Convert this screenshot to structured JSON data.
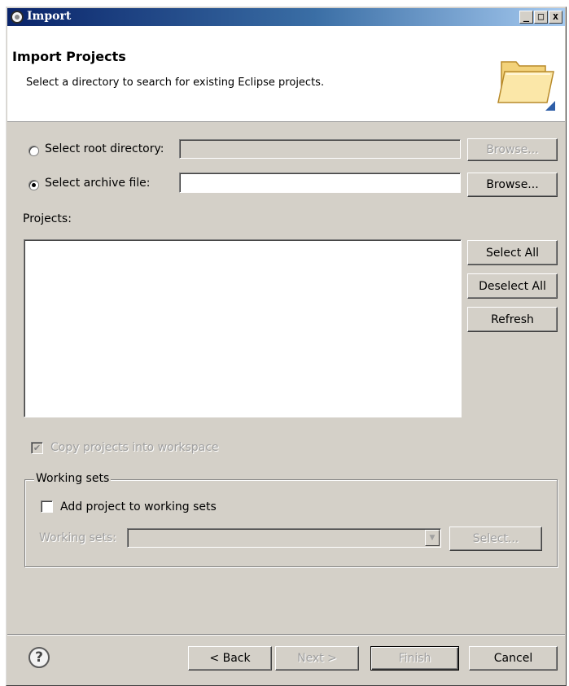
{
  "window": {
    "title": "Import",
    "minimize_label": "_",
    "maximize_label": "□",
    "close_label": "x"
  },
  "banner": {
    "title": "Import Projects",
    "description": "Select a directory to search for existing Eclipse projects."
  },
  "source": {
    "root_directory": {
      "label": "Select root directory:",
      "selected": false,
      "value": "",
      "browse_label": "Browse...",
      "browse_enabled": false
    },
    "archive_file": {
      "label": "Select archive file:",
      "selected": true,
      "value": "",
      "browse_label": "Browse...",
      "browse_enabled": true
    }
  },
  "projects": {
    "label": "Projects:",
    "items": [],
    "select_all_label": "Select All",
    "deselect_all_label": "Deselect All",
    "refresh_label": "Refresh"
  },
  "copy_projects": {
    "label": "Copy projects into workspace",
    "checked": true,
    "enabled": false
  },
  "working_sets_group": {
    "title": "Working sets",
    "add_label": "Add project to working sets",
    "add_checked": false,
    "sets_label": "Working sets:",
    "sets_value": "",
    "select_label": "Select..."
  },
  "footer": {
    "help_icon": "question-mark-icon",
    "back_label": "< Back",
    "next_label": "Next >",
    "finish_label": "Finish",
    "cancel_label": "Cancel"
  }
}
